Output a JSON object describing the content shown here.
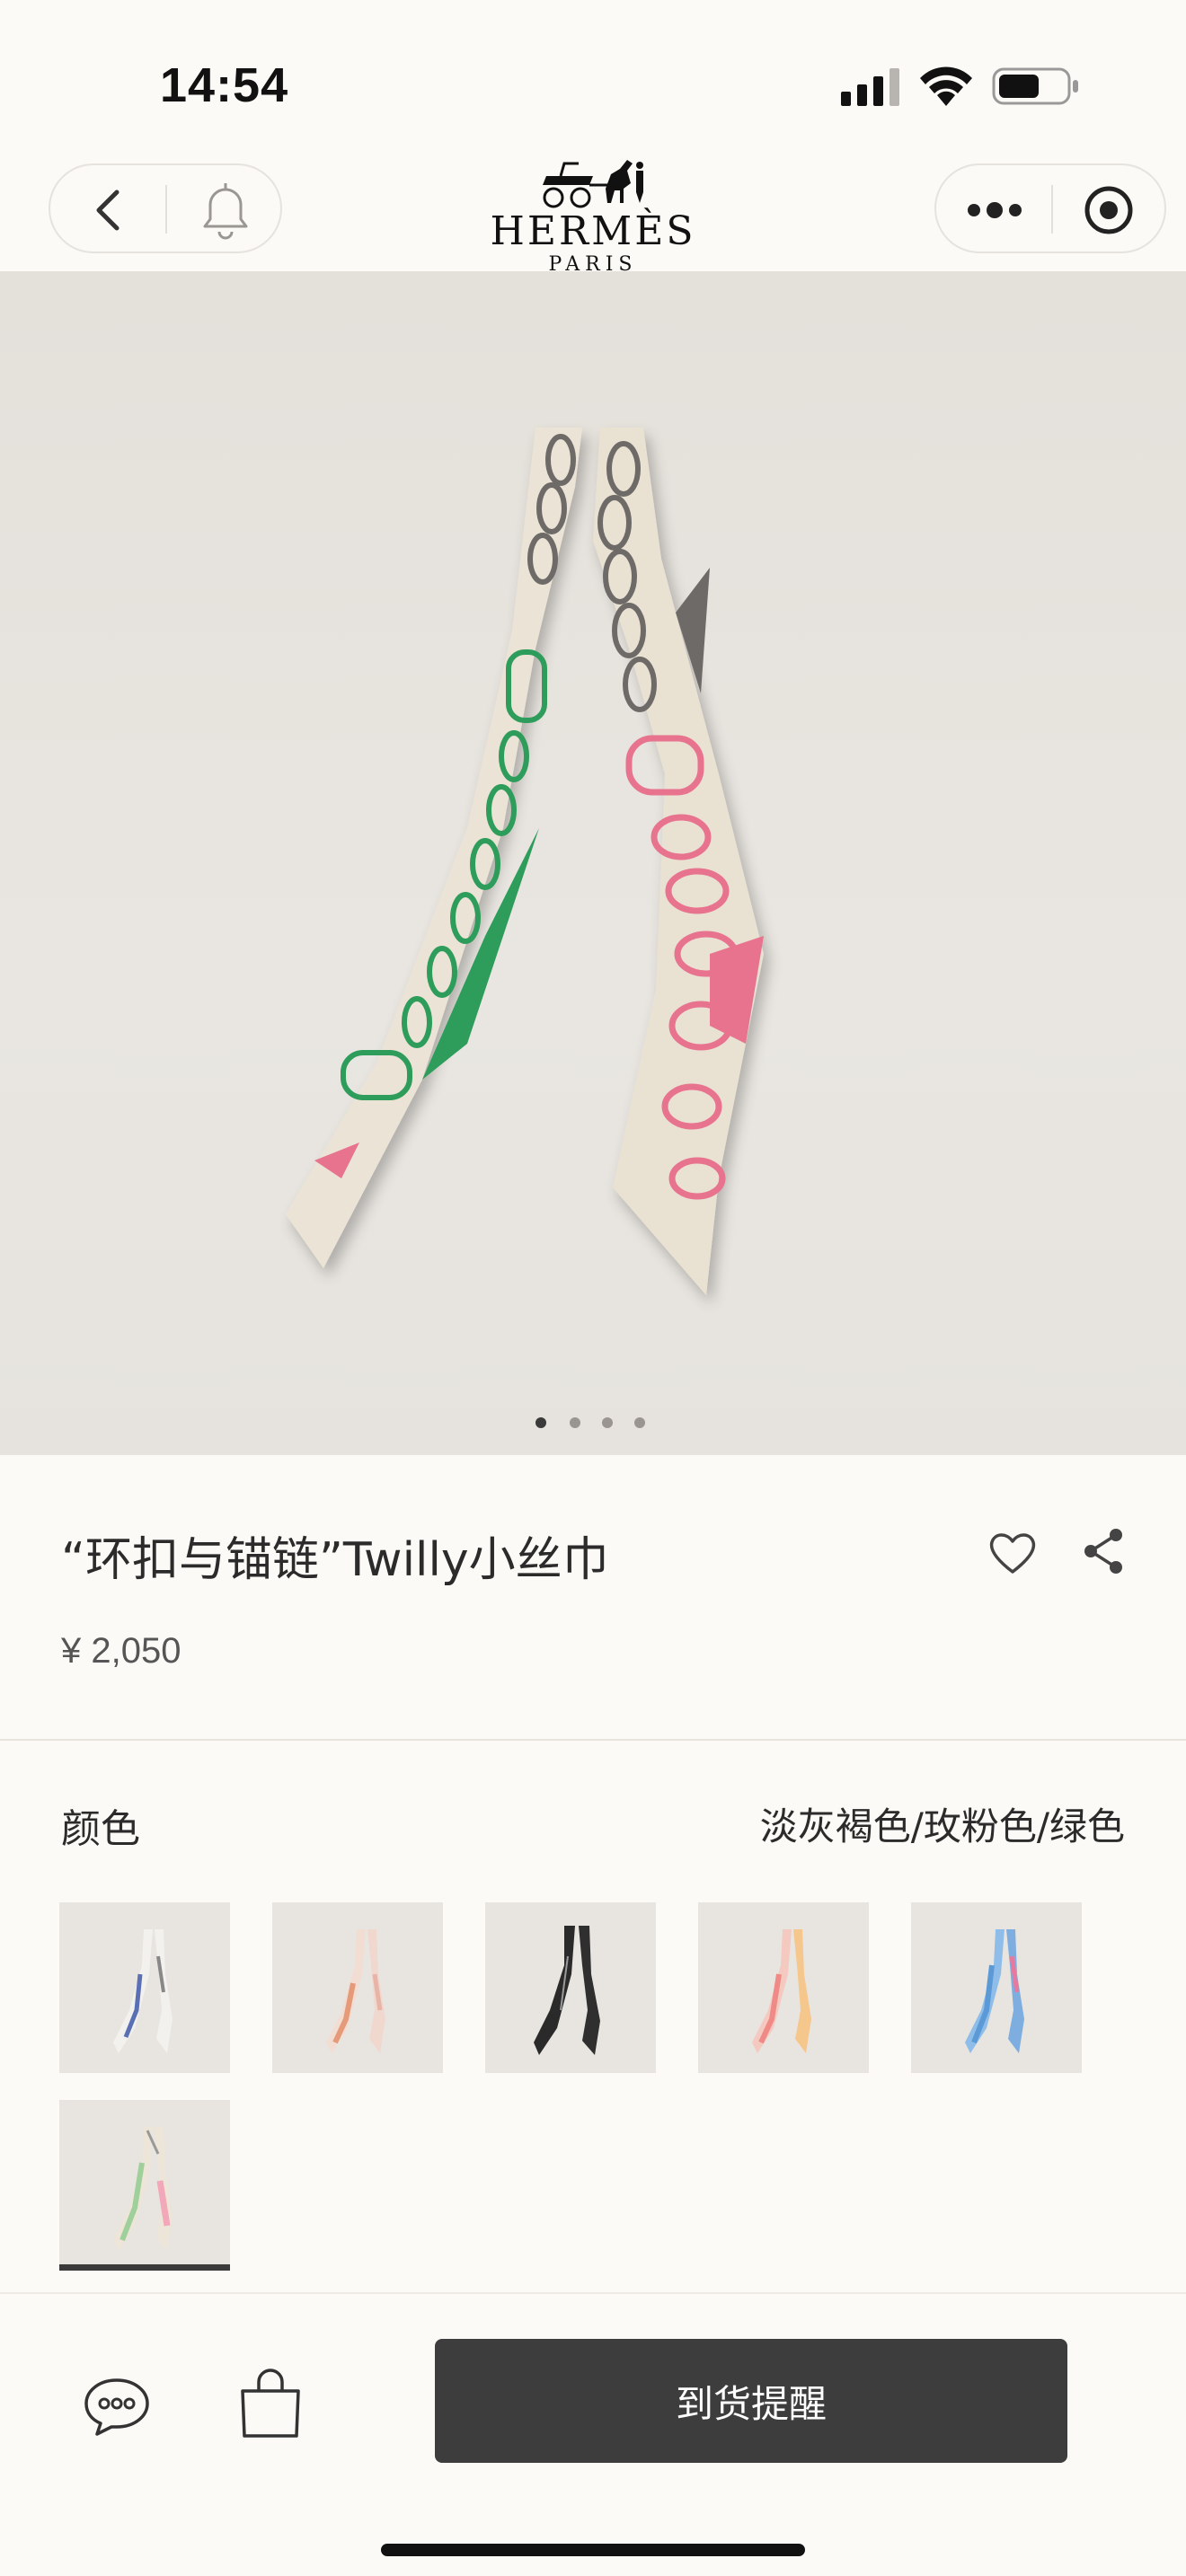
{
  "status_bar": {
    "time": "14:54",
    "icons": [
      "cellular-signal-icon",
      "wifi-icon",
      "battery-icon"
    ]
  },
  "nav": {
    "brand": "HERMÈS",
    "brand_sub": "PARIS",
    "icons": [
      "back-arrow-icon",
      "bell-icon",
      "more-dots-icon",
      "target-icon"
    ]
  },
  "gallery": {
    "image_count": 4,
    "active_index": 0
  },
  "product": {
    "title": "“环扣与锚链”Twilly小丝巾",
    "price": "¥ 2,050"
  },
  "color": {
    "label": "颜色",
    "selected": "淡灰褐色/玫粉色/绿色",
    "swatch_count": 6,
    "selected_index": 5,
    "swatch_accents": [
      "#5b6fb5",
      "#e59a7a",
      "#2a2a2a",
      "#ef8a86",
      "#5b9ad6",
      "#9fcf9a"
    ]
  },
  "bottom_bar": {
    "cta_label": "到货提醒",
    "icons": [
      "chat-bubble-icon",
      "shopping-bag-icon"
    ]
  },
  "colors": {
    "background": "#fcfaf6",
    "cta": "#3d3d3d",
    "scarf_base": "#e9e1d2",
    "scarf_green": "#2e9c5a",
    "scarf_pink": "#e8738f",
    "scarf_grey": "#6e6a68"
  }
}
